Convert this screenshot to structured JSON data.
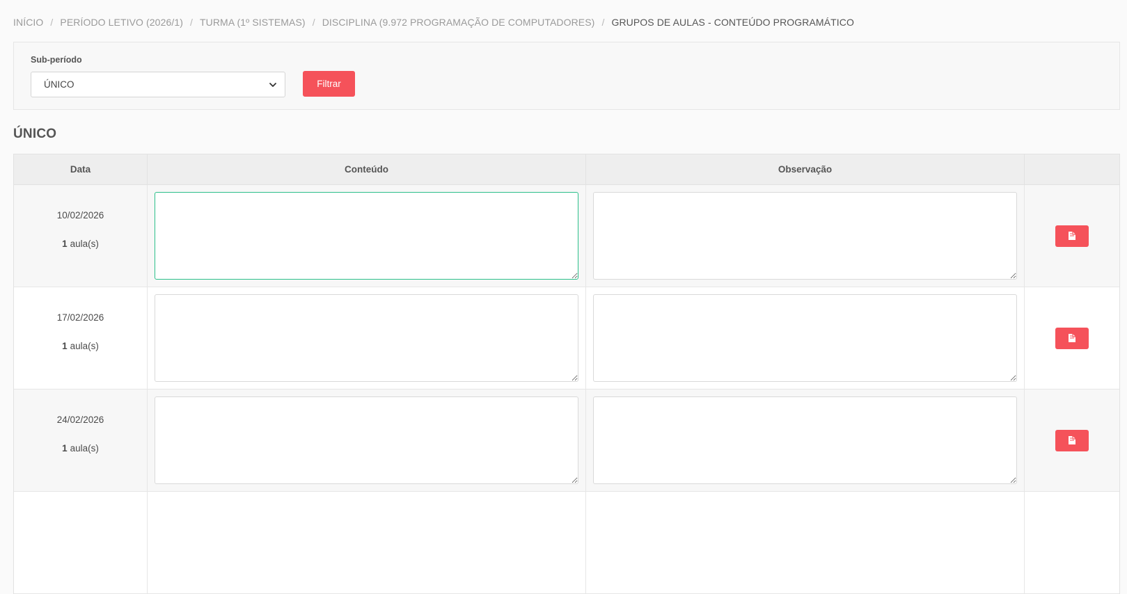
{
  "breadcrumb": [
    {
      "label": "INÍCIO"
    },
    {
      "label": "PERÍODO LETIVO (2026/1)"
    },
    {
      "label": "TURMA (1º SISTEMAS)"
    },
    {
      "label": "DISCIPLINA (9.972 PROGRAMAÇÃO DE COMPUTADORES)"
    },
    {
      "label": "GRUPOS DE AULAS - CONTEÚDO PROGRAMÁTICO"
    }
  ],
  "breadcrumb_separator": "/",
  "filter": {
    "label": "Sub-período",
    "selected": "ÚNICO",
    "button_label": "Filtrar"
  },
  "section": {
    "title": "ÚNICO"
  },
  "table": {
    "headers": {
      "date": "Data",
      "content": "Conteúdo",
      "observation": "Observação",
      "actions": ""
    },
    "rows": [
      {
        "date": "10/02/2026",
        "lessons_count": "1",
        "lessons_suffix": "aula(s)",
        "content": "",
        "observation": "",
        "action_icon": "document-icon"
      },
      {
        "date": "17/02/2026",
        "lessons_count": "1",
        "lessons_suffix": "aula(s)",
        "content": "",
        "observation": "",
        "action_icon": "document-icon"
      },
      {
        "date": "24/02/2026",
        "lessons_count": "1",
        "lessons_suffix": "aula(s)",
        "content": "",
        "observation": "",
        "action_icon": "document-icon"
      }
    ]
  },
  "colors": {
    "accent": "#f5525a",
    "focus_border": "#2bbf8a"
  }
}
